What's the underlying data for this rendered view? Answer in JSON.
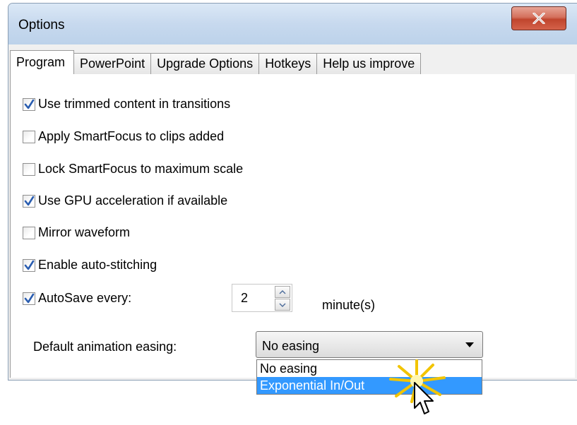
{
  "window": {
    "title": "Options",
    "close_glyph": "X"
  },
  "tabs": [
    {
      "label": "Program",
      "active": true
    },
    {
      "label": "PowerPoint",
      "active": false
    },
    {
      "label": "Upgrade Options",
      "active": false
    },
    {
      "label": "Hotkeys",
      "active": false
    },
    {
      "label": "Help us improve",
      "active": false
    }
  ],
  "options": [
    {
      "label": "Use trimmed content in transitions",
      "checked": true
    },
    {
      "label": "Apply SmartFocus to clips added",
      "checked": false
    },
    {
      "label": "Lock SmartFocus to maximum scale",
      "checked": false
    },
    {
      "label": "Use GPU acceleration if available",
      "checked": true
    },
    {
      "label": "Mirror waveform",
      "checked": false
    },
    {
      "label": "Enable auto-stitching",
      "checked": true
    },
    {
      "label": "AutoSave every:",
      "checked": true
    }
  ],
  "autosave": {
    "value": "2",
    "unit_label": "minute(s)"
  },
  "easing": {
    "label": "Default animation easing:",
    "selected": "No easing",
    "options": [
      "No easing",
      "Exponential In/Out"
    ],
    "highlighted": "Exponential In/Out"
  },
  "colors": {
    "highlight": "#3399ff",
    "check": "#2a5db0",
    "close_button": "#c0452d"
  },
  "icons": {
    "close": "close-icon",
    "checkmark": "checkmark-icon",
    "spin_up": "arrow-up-icon",
    "spin_down": "arrow-down-icon",
    "dropdown": "chevron-down-icon",
    "cursor": "pointer-cursor-icon",
    "burst": "click-burst-icon"
  }
}
